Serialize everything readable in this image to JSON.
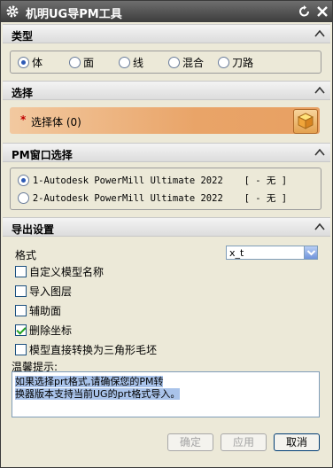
{
  "window": {
    "title": "机明UG导PM工具",
    "icons": {
      "settings": "gear-icon",
      "reset": "reset-icon",
      "close": "close-icon"
    }
  },
  "type_section": {
    "title": "类型",
    "options": [
      {
        "label": "体",
        "selected": true
      },
      {
        "label": "面",
        "selected": false
      },
      {
        "label": "线",
        "selected": false
      },
      {
        "label": "混合",
        "selected": false
      },
      {
        "label": "刀路",
        "selected": false
      }
    ]
  },
  "select_section": {
    "title": "选择",
    "required_mark": "*",
    "label": "选择体 (0)",
    "button_icon": "cube-icon"
  },
  "pm_section": {
    "title": "PM窗口选择",
    "windows": [
      {
        "name": "1-Autodesk PowerMill Ultimate 2022",
        "status": "[ - 无 ]",
        "selected": true
      },
      {
        "name": "2-Autodesk PowerMill Ultimate 2022",
        "status": "[ - 无 ]",
        "selected": false
      }
    ]
  },
  "export_section": {
    "title": "导出设置",
    "format_label": "格式",
    "format_value": "x_t",
    "options": [
      {
        "label": "自定义模型名称",
        "checked": false
      },
      {
        "label": "导入图层",
        "checked": false
      },
      {
        "label": "辅助面",
        "checked": false
      },
      {
        "label": "删除坐标",
        "checked": true
      },
      {
        "label": "模型直接转换为三角形毛坯",
        "checked": false
      }
    ],
    "hint_label": "温馨提示:",
    "hint_lines": [
      "如果选择prt格式,请确保您的PM转",
      "换器版本支持当前UG的prt格式导入。"
    ]
  },
  "buttons": {
    "ok": "确定",
    "apply": "应用",
    "cancel": "取消"
  },
  "colors": {
    "accent": "#2d5ab5",
    "select_bar": "#e9a468",
    "required": "#c00000",
    "check": "#21a121"
  }
}
